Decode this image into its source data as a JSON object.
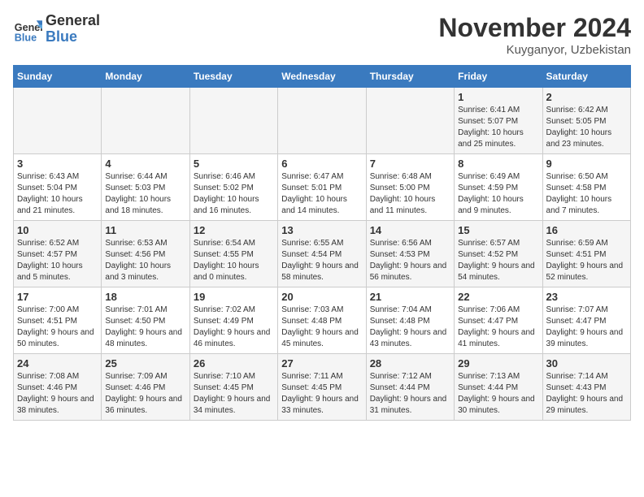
{
  "header": {
    "logo": {
      "general": "General",
      "blue": "Blue"
    },
    "title": "November 2024",
    "location": "Kuyganyor, Uzbekistan"
  },
  "days_of_week": [
    "Sunday",
    "Monday",
    "Tuesday",
    "Wednesday",
    "Thursday",
    "Friday",
    "Saturday"
  ],
  "weeks": [
    [
      {
        "day": "",
        "info": ""
      },
      {
        "day": "",
        "info": ""
      },
      {
        "day": "",
        "info": ""
      },
      {
        "day": "",
        "info": ""
      },
      {
        "day": "",
        "info": ""
      },
      {
        "day": "1",
        "info": "Sunrise: 6:41 AM\nSunset: 5:07 PM\nDaylight: 10 hours and 25 minutes."
      },
      {
        "day": "2",
        "info": "Sunrise: 6:42 AM\nSunset: 5:05 PM\nDaylight: 10 hours and 23 minutes."
      }
    ],
    [
      {
        "day": "3",
        "info": "Sunrise: 6:43 AM\nSunset: 5:04 PM\nDaylight: 10 hours and 21 minutes."
      },
      {
        "day": "4",
        "info": "Sunrise: 6:44 AM\nSunset: 5:03 PM\nDaylight: 10 hours and 18 minutes."
      },
      {
        "day": "5",
        "info": "Sunrise: 6:46 AM\nSunset: 5:02 PM\nDaylight: 10 hours and 16 minutes."
      },
      {
        "day": "6",
        "info": "Sunrise: 6:47 AM\nSunset: 5:01 PM\nDaylight: 10 hours and 14 minutes."
      },
      {
        "day": "7",
        "info": "Sunrise: 6:48 AM\nSunset: 5:00 PM\nDaylight: 10 hours and 11 minutes."
      },
      {
        "day": "8",
        "info": "Sunrise: 6:49 AM\nSunset: 4:59 PM\nDaylight: 10 hours and 9 minutes."
      },
      {
        "day": "9",
        "info": "Sunrise: 6:50 AM\nSunset: 4:58 PM\nDaylight: 10 hours and 7 minutes."
      }
    ],
    [
      {
        "day": "10",
        "info": "Sunrise: 6:52 AM\nSunset: 4:57 PM\nDaylight: 10 hours and 5 minutes."
      },
      {
        "day": "11",
        "info": "Sunrise: 6:53 AM\nSunset: 4:56 PM\nDaylight: 10 hours and 3 minutes."
      },
      {
        "day": "12",
        "info": "Sunrise: 6:54 AM\nSunset: 4:55 PM\nDaylight: 10 hours and 0 minutes."
      },
      {
        "day": "13",
        "info": "Sunrise: 6:55 AM\nSunset: 4:54 PM\nDaylight: 9 hours and 58 minutes."
      },
      {
        "day": "14",
        "info": "Sunrise: 6:56 AM\nSunset: 4:53 PM\nDaylight: 9 hours and 56 minutes."
      },
      {
        "day": "15",
        "info": "Sunrise: 6:57 AM\nSunset: 4:52 PM\nDaylight: 9 hours and 54 minutes."
      },
      {
        "day": "16",
        "info": "Sunrise: 6:59 AM\nSunset: 4:51 PM\nDaylight: 9 hours and 52 minutes."
      }
    ],
    [
      {
        "day": "17",
        "info": "Sunrise: 7:00 AM\nSunset: 4:51 PM\nDaylight: 9 hours and 50 minutes."
      },
      {
        "day": "18",
        "info": "Sunrise: 7:01 AM\nSunset: 4:50 PM\nDaylight: 9 hours and 48 minutes."
      },
      {
        "day": "19",
        "info": "Sunrise: 7:02 AM\nSunset: 4:49 PM\nDaylight: 9 hours and 46 minutes."
      },
      {
        "day": "20",
        "info": "Sunrise: 7:03 AM\nSunset: 4:48 PM\nDaylight: 9 hours and 45 minutes."
      },
      {
        "day": "21",
        "info": "Sunrise: 7:04 AM\nSunset: 4:48 PM\nDaylight: 9 hours and 43 minutes."
      },
      {
        "day": "22",
        "info": "Sunrise: 7:06 AM\nSunset: 4:47 PM\nDaylight: 9 hours and 41 minutes."
      },
      {
        "day": "23",
        "info": "Sunrise: 7:07 AM\nSunset: 4:47 PM\nDaylight: 9 hours and 39 minutes."
      }
    ],
    [
      {
        "day": "24",
        "info": "Sunrise: 7:08 AM\nSunset: 4:46 PM\nDaylight: 9 hours and 38 minutes."
      },
      {
        "day": "25",
        "info": "Sunrise: 7:09 AM\nSunset: 4:46 PM\nDaylight: 9 hours and 36 minutes."
      },
      {
        "day": "26",
        "info": "Sunrise: 7:10 AM\nSunset: 4:45 PM\nDaylight: 9 hours and 34 minutes."
      },
      {
        "day": "27",
        "info": "Sunrise: 7:11 AM\nSunset: 4:45 PM\nDaylight: 9 hours and 33 minutes."
      },
      {
        "day": "28",
        "info": "Sunrise: 7:12 AM\nSunset: 4:44 PM\nDaylight: 9 hours and 31 minutes."
      },
      {
        "day": "29",
        "info": "Sunrise: 7:13 AM\nSunset: 4:44 PM\nDaylight: 9 hours and 30 minutes."
      },
      {
        "day": "30",
        "info": "Sunrise: 7:14 AM\nSunset: 4:43 PM\nDaylight: 9 hours and 29 minutes."
      }
    ]
  ]
}
